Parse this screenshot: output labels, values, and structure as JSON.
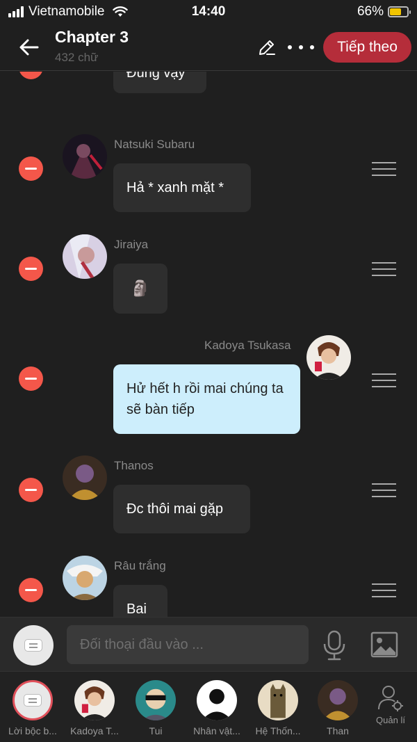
{
  "status_bar": {
    "carrier": "Vietnamobile",
    "time": "14:40",
    "battery_percent": "66%",
    "battery_level": 0.66
  },
  "header": {
    "title": "Chapter 3",
    "subtitle": "432 chữ",
    "next_label": "Tiếp theo"
  },
  "messages": [
    {
      "sender": "",
      "text": "Đúng vậy",
      "mine": false
    },
    {
      "sender": "Natsuki Subaru",
      "text": "Hả * xanh mặt *",
      "mine": false
    },
    {
      "sender": "Jiraiya",
      "text": "🗿",
      "mine": false
    },
    {
      "sender": "Kadoya Tsukasa",
      "text": "Hử hết h rồi mai chúng ta sẽ bàn tiếp",
      "mine": true
    },
    {
      "sender": "Thanos",
      "text": "Đc thôi mai gặp",
      "mine": false
    },
    {
      "sender": "Râu trắng",
      "text": "Bai",
      "mine": false
    }
  ],
  "composer": {
    "placeholder": "Đối thoại đầu vào ..."
  },
  "characters": [
    {
      "label": "Lời bộc b..."
    },
    {
      "label": "Kadoya T..."
    },
    {
      "label": "Tui"
    },
    {
      "label": "Nhân vật..."
    },
    {
      "label": "Hệ Thốn..."
    },
    {
      "label": "Than"
    }
  ],
  "manage_label": "Quản lí",
  "colors": {
    "background": "#1f1f1f",
    "accent": "#b52d3a",
    "delete": "#f4574a",
    "my_bubble": "#cdeefc",
    "other_bubble": "#2e2e2e"
  }
}
